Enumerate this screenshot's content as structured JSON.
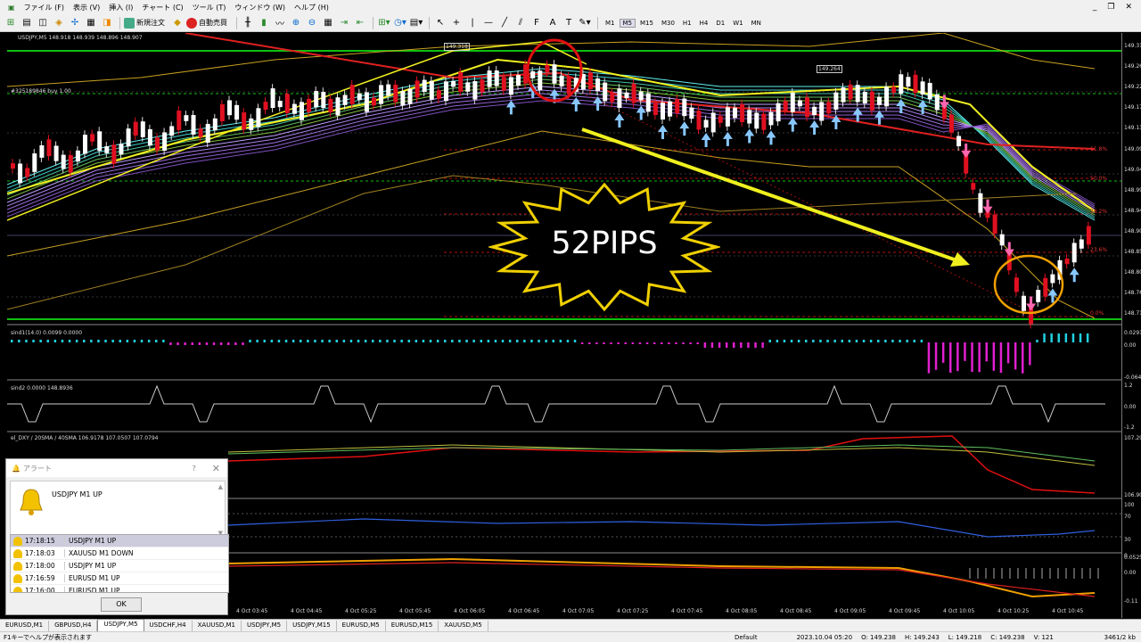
{
  "menu": [
    "ファイル (F)",
    "表示 (V)",
    "挿入 (I)",
    "チャート (C)",
    "ツール (T)",
    "ウィンドウ (W)",
    "ヘルプ (H)"
  ],
  "toolbar": {
    "new_order": "新規注文",
    "auto_trade": "自動売買",
    "timeframes": [
      "M1",
      "M5",
      "M15",
      "M30",
      "H1",
      "H4",
      "D1",
      "W1",
      "MN"
    ],
    "active_timeframe": "M5"
  },
  "chart": {
    "header": "USDJPY,M5  148.918 148.939 148.896 148.907",
    "order_label": "#325189846 buy 1.00",
    "price_tag_1": "149.318",
    "price_tag_2": "149.264",
    "indicator_1": "sind1(14.0) 0.0099 0.0000",
    "indicator_2": "sind2 0.0000 148.8936",
    "indicator_3": "el_DXY / 20SMA / 40SMA 106.9178 107.0507 107.0794",
    "fib_labels": [
      "61.8%",
      "50.0%",
      "38.2%",
      "23.6%",
      "0.0%"
    ],
    "time_labels": [
      "4 Oct 03:45",
      "4 Oct 04:45",
      "4 Oct 05:25",
      "4 Oct 05:45",
      "4 Oct 06:05",
      "4 Oct 06:45",
      "4 Oct 07:05",
      "4 Oct 07:25",
      "4 Oct 07:45",
      "4 Oct 08:05",
      "4 Oct 08:45",
      "4 Oct 09:05",
      "4 Oct 09:45",
      "4 Oct 10:05",
      "4 Oct 10:25",
      "4 Oct 10:45"
    ],
    "annotation": "52PIPS"
  },
  "price_axis": [
    "149.31",
    "149.26",
    "149.22",
    "149.17",
    "149.13",
    "149.09",
    "149.04",
    "148.99",
    "148.94",
    "148.90",
    "148.85",
    "148.80",
    "148.76",
    "148.71"
  ],
  "sub_axis": {
    "ind1": [
      "0.0291",
      "0.00",
      "-0.0648"
    ],
    "ind2": [
      "1.2",
      "0.00",
      "-1.2"
    ],
    "ind3": [
      "107.29",
      "106.90"
    ],
    "ind4": [
      "100",
      "70",
      "30",
      "0"
    ],
    "ind5": [
      "0.0525",
      "0.00",
      "-0.11"
    ]
  },
  "alert": {
    "title": "アラート",
    "message": "USDJPY M1 UP",
    "rows": [
      {
        "time": "17:18:15",
        "msg": "USDJPY M1 UP"
      },
      {
        "time": "17:18:03",
        "msg": "XAUUSD M1 DOWN"
      },
      {
        "time": "17:18:00",
        "msg": "USDJPY M1 UP"
      },
      {
        "time": "17:16:59",
        "msg": "EURUSD M1 UP"
      },
      {
        "time": "17:16:00",
        "msg": "EURUSD M1 UP"
      }
    ],
    "ok": "OK"
  },
  "tabs": [
    "EURUSD,M1",
    "GBPUSD,H4",
    "USDJPY,M5",
    "USDCHF,H4",
    "XAUUSD,M1",
    "USDJPY,M5",
    "USDJPY,M15",
    "EURUSD,M5",
    "EURUSD,M15",
    "XAUUSD,M5"
  ],
  "active_tab_index": 2,
  "status": {
    "help": "F1キーでヘルプが表示されます",
    "profile": "Default",
    "datetime": "2023.10.04 05:20",
    "open": "O: 149.238",
    "high": "H: 149.243",
    "low": "L: 149.218",
    "close": "C: 149.238",
    "volume": "V: 121",
    "traffic": "3461/2 kb"
  },
  "colors": {
    "bull": "#ffffff",
    "bear": "#e01020",
    "up_arrow": "#88c8ff",
    "down_arrow": "#ff66b0",
    "annotation_arrow": "#f0f020",
    "histogram_up": "#20d0e0",
    "histogram_down": "#e020d0"
  }
}
